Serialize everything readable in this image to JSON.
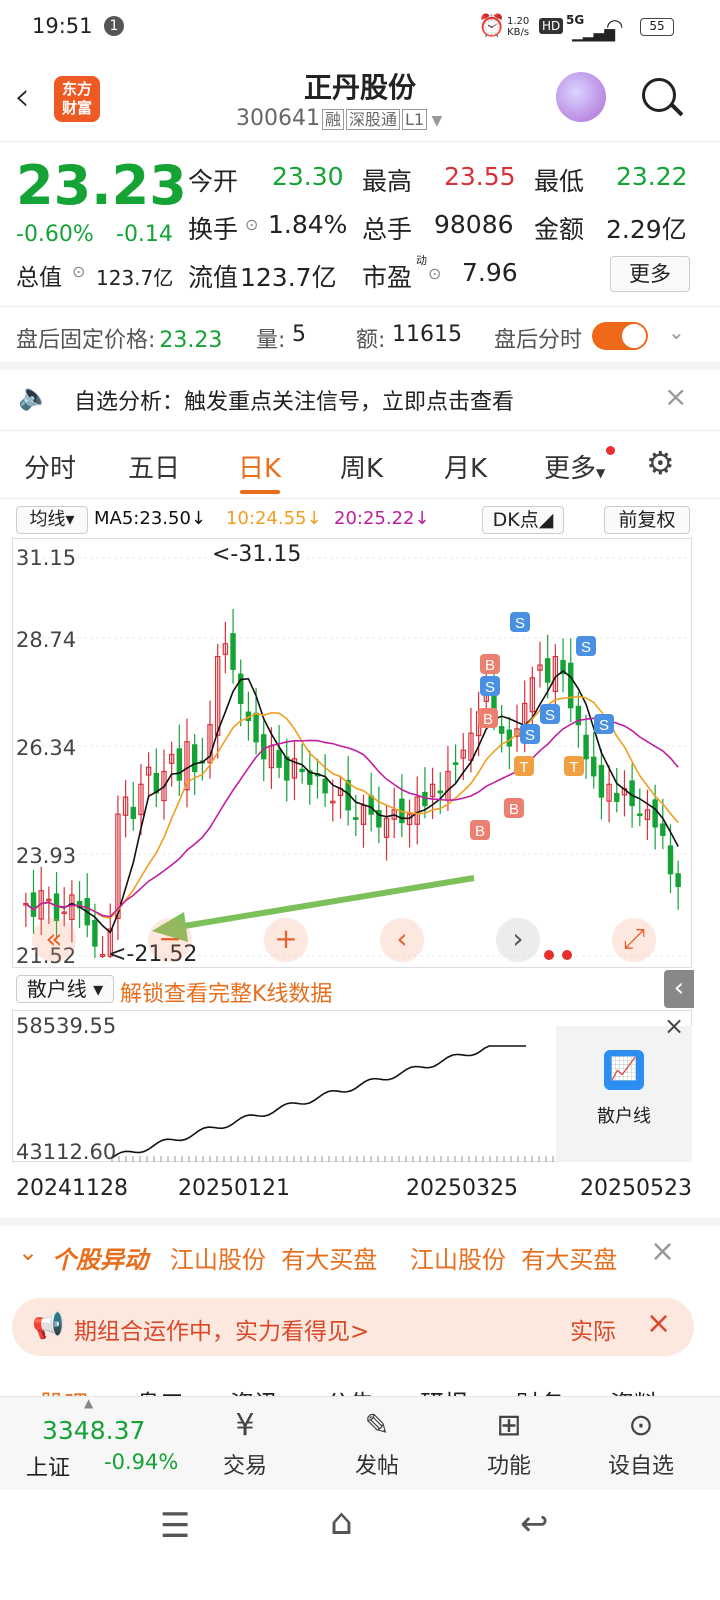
{
  "status": {
    "time": "19:51",
    "badge": "1",
    "net_speed": "1.20",
    "net_unit": "KB/s",
    "hd": "HD",
    "signal": "5G",
    "battery": "55"
  },
  "header": {
    "logo_line1": "东方",
    "logo_line2": "财富",
    "title": "正丹股份",
    "code": "300641",
    "tag_rong": "融",
    "tag_sgt": "深股通",
    "tag_level": "L1"
  },
  "quote": {
    "price": "23.23",
    "change_pct": "-0.60%",
    "change": "-0.14",
    "open_label": "今开",
    "open": "23.30",
    "high_label": "最高",
    "high": "23.55",
    "low_label": "最低",
    "low": "23.22",
    "turnover_label": "换手",
    "turnover": "1.84%",
    "volume_label": "总手",
    "volume": "98086",
    "amount_label": "金额",
    "amount": "2.29亿",
    "mktcap_label": "总值",
    "mktcap": "123.7亿",
    "float_label": "流值",
    "float": "123.7亿",
    "pe_label": "市盈",
    "pe_sup": "动",
    "pe": "7.96",
    "more": "更多"
  },
  "afterhours": {
    "label": "盘后固定价格:",
    "price": "23.23",
    "vol_label": "量:",
    "vol": "5",
    "amt_label": "额:",
    "amt": "11615",
    "timeshare_label": "盘后分时"
  },
  "notice": {
    "text": "自选分析：触发重点关注信号，立即点击查看"
  },
  "tabs": [
    "分时",
    "五日",
    "日K",
    "周K",
    "月K",
    "更多"
  ],
  "ma": {
    "selector": "均线",
    "ma5": "MA5:23.50",
    "ma10": "10:24.55",
    "ma20": "20:25.22",
    "dk": "DK点",
    "adjust": "前复权"
  },
  "chart_data": {
    "type": "candlestick",
    "y_ticks": [
      "31.15",
      "28.74",
      "26.34",
      "23.93",
      "21.52"
    ],
    "ylim": [
      21.52,
      31.15
    ],
    "max_label": "<-31.15",
    "min_label": "<-21.52",
    "x_ticks": [
      "20241128",
      "20250121",
      "20250325",
      "20250523"
    ],
    "signals": [
      "B",
      "B",
      "B",
      "S",
      "S",
      "S",
      "S",
      "S",
      "S",
      "T",
      "T",
      "B"
    ],
    "indicator_name": "散户线",
    "indicator_max": "58539.55",
    "indicator_min": "43112.60",
    "series": [
      {
        "name": "MA5",
        "color": "#111111"
      },
      {
        "name": "MA10",
        "color": "#f0a020"
      },
      {
        "name": "MA20",
        "color": "#c020a0"
      }
    ]
  },
  "indicator": {
    "selector": "散户线",
    "unlock": "解锁查看完整K线数据",
    "card_label": "散户线"
  },
  "movers": {
    "label": "个股异动",
    "items": [
      "江山股份  有大买盘",
      "江山股份  有大买盘"
    ]
  },
  "banner": {
    "text": "期组合运作中，实力看得见>",
    "right": "实际"
  },
  "index_bar": {
    "value": "3348.37",
    "name": "上证",
    "change": "-0.94%",
    "nav": [
      "交易",
      "发帖",
      "功能",
      "设自选"
    ],
    "peek_tabs": [
      "股吧",
      "盘口",
      "资讯",
      "公告",
      "研报",
      "财务",
      "资料"
    ]
  }
}
